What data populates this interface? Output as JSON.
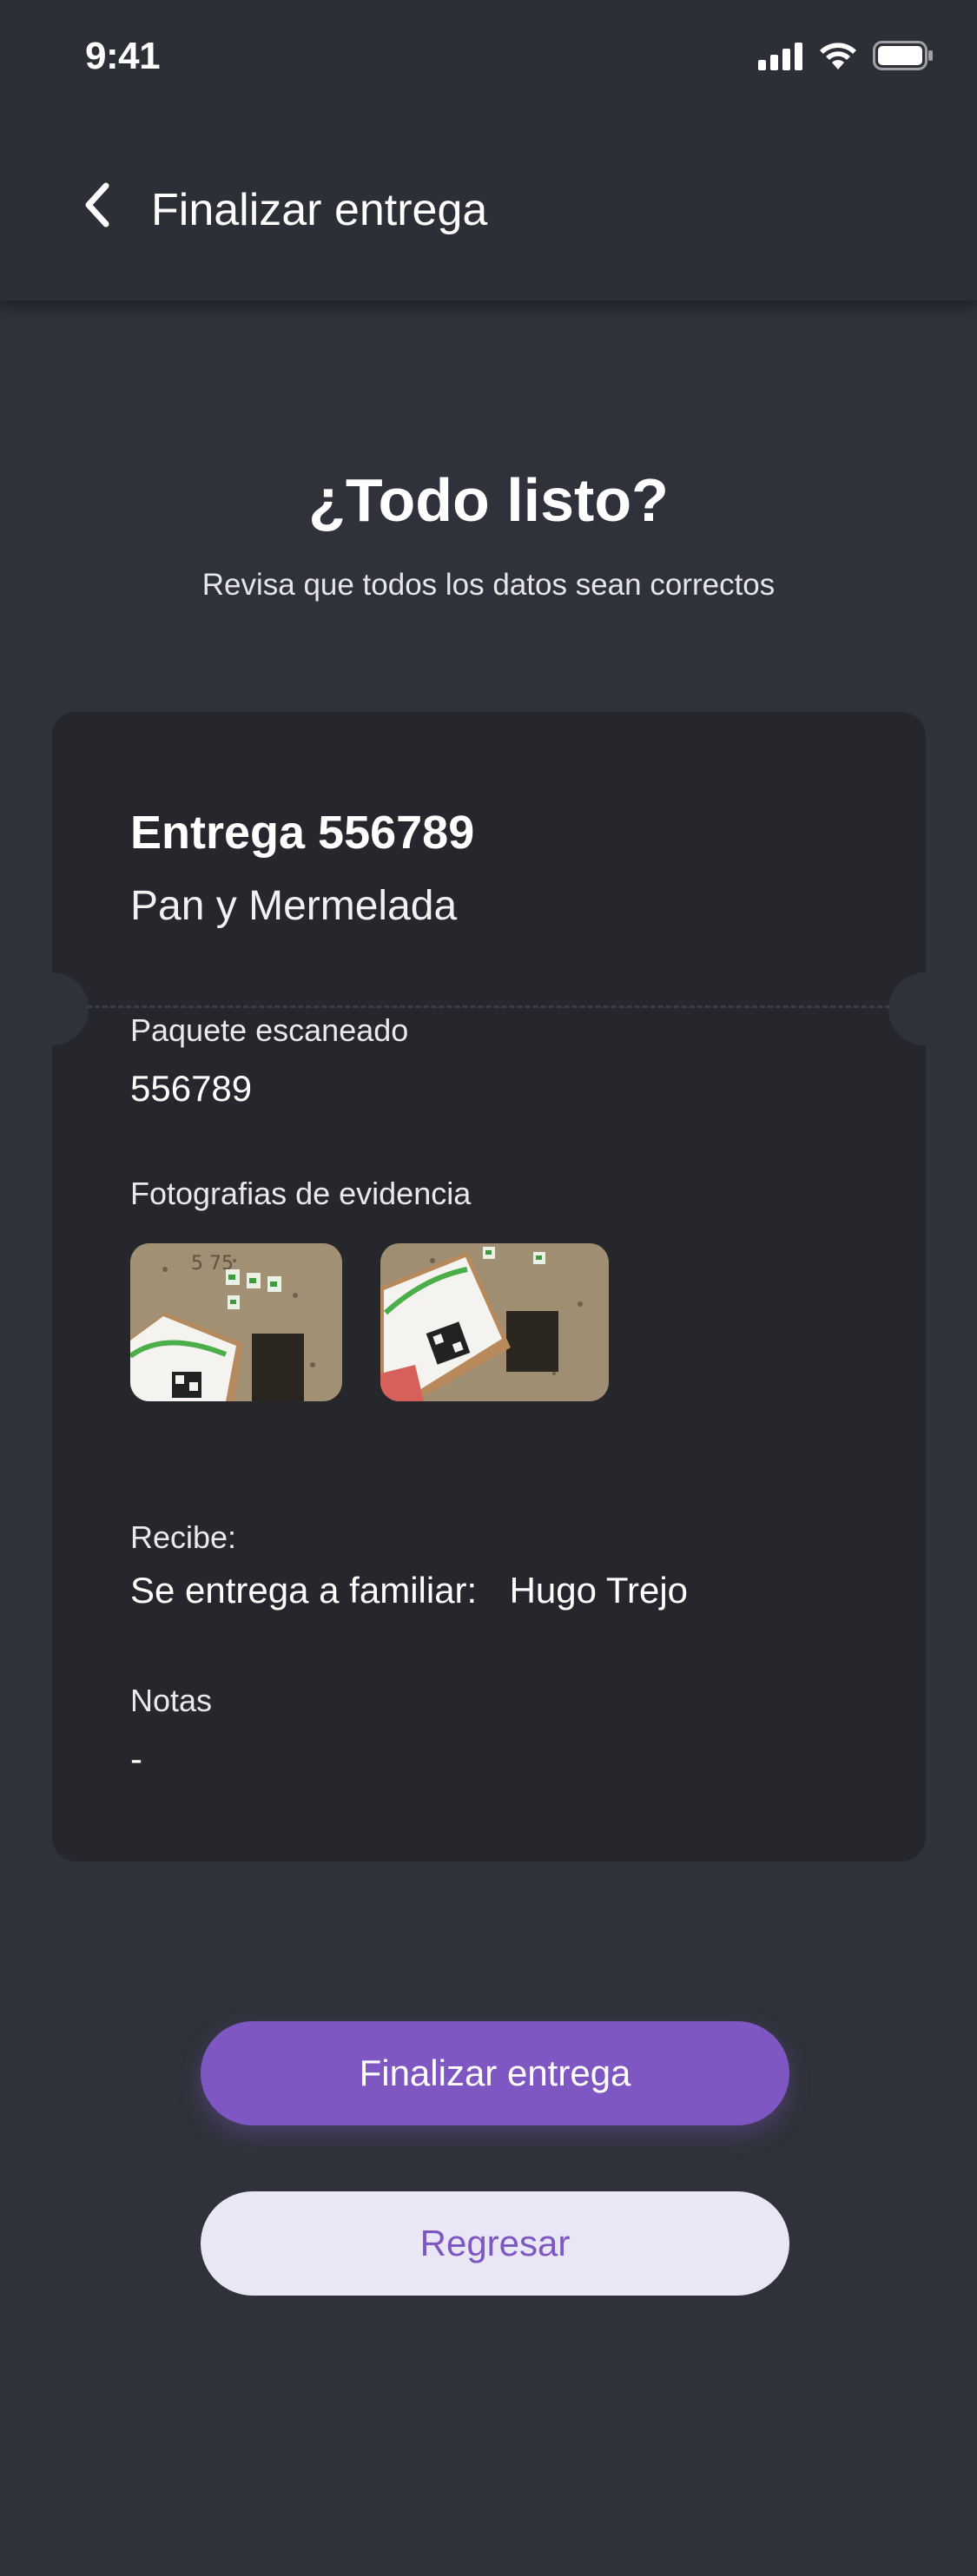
{
  "status_bar": {
    "time": "9:41"
  },
  "header": {
    "title": "Finalizar entrega"
  },
  "summary": {
    "title": "¿Todo listo?",
    "subtitle": "Revisa que todos los datos sean correctos"
  },
  "delivery": {
    "title": "Entrega 556789",
    "product": "Pan y Mermelada",
    "scanned_label": "Paquete escaneado",
    "scanned_value": "556789",
    "photos_label": "Fotografias de evidencia",
    "photos": [
      {
        "alt": "evidencia-1"
      },
      {
        "alt": "evidencia-2"
      }
    ],
    "receiver_label": "Recibe:",
    "receiver_relation": "Se entrega a familiar:",
    "receiver_name": "Hugo Trejo",
    "notes_label": "Notas",
    "notes_value": "-"
  },
  "actions": {
    "primary_label": "Finalizar entrega",
    "secondary_label": "Regresar"
  },
  "colors": {
    "background": "#2f323a",
    "card": "#25272d",
    "accent": "#7e57c2",
    "secondary_button": "#e9e6f6"
  },
  "icons": [
    "back-chevron-icon",
    "cellular-signal-icon",
    "wifi-icon",
    "battery-icon"
  ]
}
